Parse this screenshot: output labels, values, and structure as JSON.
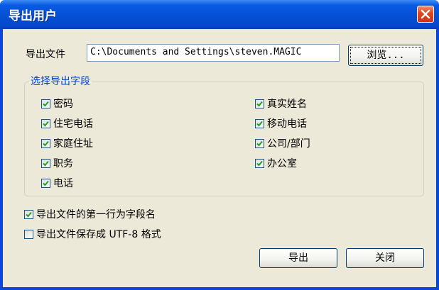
{
  "window": {
    "title": "导出用户",
    "colors": {
      "titlebar": "#0551d6",
      "client": "#ece9d8",
      "close": "#e1441c",
      "legend": "#0046d5"
    }
  },
  "file": {
    "label": "导出文件",
    "path_value": "C:\\Documents and Settings\\steven.MAGIC",
    "browse_label": "浏览..."
  },
  "fields": {
    "legend": "选择导出字段",
    "left": [
      {
        "label": "密码",
        "checked": true
      },
      {
        "label": "住宅电话",
        "checked": true
      },
      {
        "label": "家庭住址",
        "checked": true
      },
      {
        "label": "职务",
        "checked": true
      },
      {
        "label": "电话",
        "checked": true
      }
    ],
    "right": [
      {
        "label": "真实姓名",
        "checked": true
      },
      {
        "label": "移动电话",
        "checked": true
      },
      {
        "label": "公司/部门",
        "checked": true
      },
      {
        "label": "办公室",
        "checked": true
      }
    ]
  },
  "options": {
    "first_row_header": {
      "label": "导出文件的第一行为字段名",
      "checked": true
    },
    "utf8": {
      "label": "导出文件保存成 UTF-8 格式",
      "checked": false
    }
  },
  "buttons": {
    "export": "导出",
    "close": "关闭"
  },
  "icons": {
    "close": "close-x-icon",
    "check": "checkmark-icon"
  }
}
